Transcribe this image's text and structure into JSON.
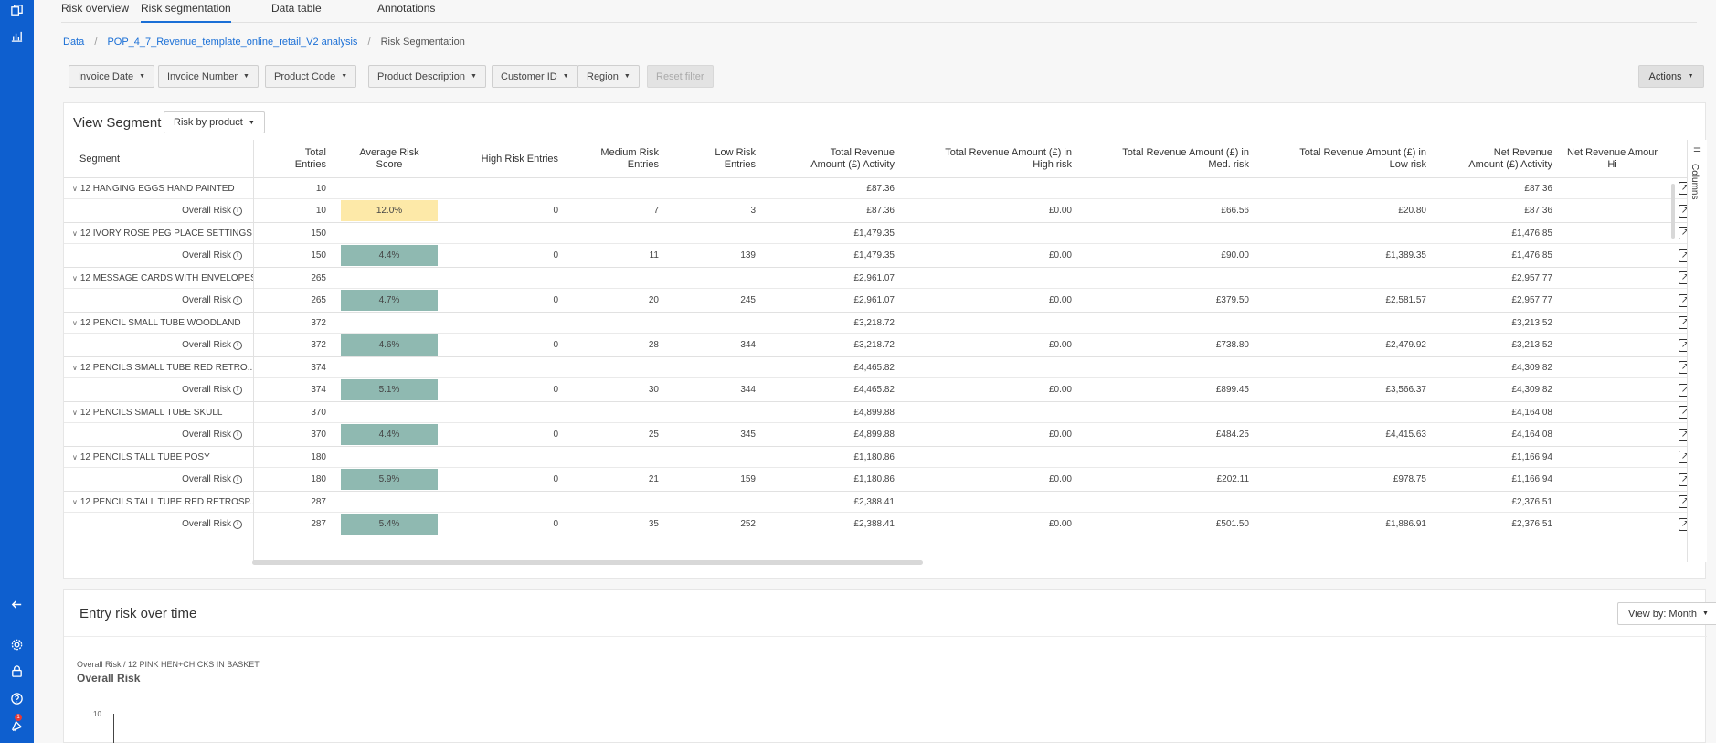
{
  "tabs": [
    "Risk overview",
    "Risk segmentation",
    "Data table",
    "Annotations"
  ],
  "active_tab": "Risk segmentation",
  "breadcrumb": {
    "root": "Data",
    "analysis": "POP_4_7_Revenue_template_online_retail_V2 analysis",
    "current": "Risk Segmentation"
  },
  "filters": [
    "Invoice Date",
    "Invoice Number",
    "Product Code",
    "Product Description",
    "Customer ID",
    "Region"
  ],
  "reset_filter": "Reset filter",
  "actions_label": "Actions",
  "view_segment": {
    "title": "View Segment",
    "selected": "Risk by product"
  },
  "columns_label": "Columns",
  "headers": {
    "segment": "Segment",
    "total_entries": [
      "Total",
      "Entries"
    ],
    "avg_score": [
      "Average Risk",
      "Score"
    ],
    "high": "High Risk Entries",
    "medium": [
      "Medium Risk",
      "Entries"
    ],
    "low": [
      "Low Risk",
      "Entries"
    ],
    "rev_activity": [
      "Total Revenue",
      "Amount (£) Activity"
    ],
    "rev_high": [
      "Total Revenue Amount (£) in",
      "High risk"
    ],
    "rev_med": [
      "Total Revenue Amount (£) in",
      "Med. risk"
    ],
    "rev_low": [
      "Total Revenue Amount (£) in",
      "Low risk"
    ],
    "net_activity": [
      "Net Revenue",
      "Amount (£) Activity"
    ],
    "net_high": [
      "Net Revenue Amour",
      "Hi"
    ]
  },
  "overall_risk_label": "Overall Risk",
  "rows": [
    {
      "name": "12 HANGING EGGS HAND PAINTED",
      "total": "10",
      "score": "12.0%",
      "high": "0",
      "medium": "7",
      "low": "3",
      "rev": "£87.36",
      "rev_high": "£0.00",
      "rev_med": "£66.56",
      "rev_low": "£20.80",
      "net": "£87.36"
    },
    {
      "name": "12 IVORY ROSE PEG PLACE SETTINGS",
      "total": "150",
      "score": "4.4%",
      "high": "0",
      "medium": "11",
      "low": "139",
      "rev": "£1,479.35",
      "rev_high": "£0.00",
      "rev_med": "£90.00",
      "rev_low": "£1,389.35",
      "net": "£1,476.85"
    },
    {
      "name": "12 MESSAGE CARDS WITH ENVELOPES",
      "total": "265",
      "score": "4.7%",
      "high": "0",
      "medium": "20",
      "low": "245",
      "rev": "£2,961.07",
      "rev_high": "£0.00",
      "rev_med": "£379.50",
      "rev_low": "£2,581.57",
      "net": "£2,957.77"
    },
    {
      "name": "12 PENCIL SMALL TUBE WOODLAND",
      "total": "372",
      "score": "4.6%",
      "high": "0",
      "medium": "28",
      "low": "344",
      "rev": "£3,218.72",
      "rev_high": "£0.00",
      "rev_med": "£738.80",
      "rev_low": "£2,479.92",
      "net": "£3,213.52"
    },
    {
      "name": "12 PENCILS SMALL TUBE RED RETRO...",
      "total": "374",
      "score": "5.1%",
      "high": "0",
      "medium": "30",
      "low": "344",
      "rev": "£4,465.82",
      "rev_high": "£0.00",
      "rev_med": "£899.45",
      "rev_low": "£3,566.37",
      "net": "£4,309.82"
    },
    {
      "name": "12 PENCILS SMALL TUBE SKULL",
      "total": "370",
      "score": "4.4%",
      "high": "0",
      "medium": "25",
      "low": "345",
      "rev": "£4,899.88",
      "rev_high": "£0.00",
      "rev_med": "£484.25",
      "rev_low": "£4,415.63",
      "net": "£4,164.08"
    },
    {
      "name": "12 PENCILS TALL TUBE POSY",
      "total": "180",
      "score": "5.9%",
      "high": "0",
      "medium": "21",
      "low": "159",
      "rev": "£1,180.86",
      "rev_high": "£0.00",
      "rev_med": "£202.11",
      "rev_low": "£978.75",
      "net": "£1,166.94"
    },
    {
      "name": "12 PENCILS TALL TUBE RED RETROSP...",
      "total": "287",
      "score": "5.4%",
      "high": "0",
      "medium": "35",
      "low": "252",
      "rev": "£2,388.41",
      "rev_high": "£0.00",
      "rev_med": "£501.50",
      "rev_low": "£1,886.91",
      "net": "£2,376.51"
    }
  ],
  "colors": {
    "accent": "#0e5fcf",
    "score_high": "#fde9a8",
    "score_normal": "#8fb9b1"
  },
  "chart_panel": {
    "title": "Entry risk over time",
    "view_by": "View by: Month",
    "subtitle": "Overall Risk / 12 PINK HEN+CHICKS IN BASKET",
    "heading": "Overall Risk",
    "y_tick": "10"
  },
  "sidebar_icons": [
    "pages-icon",
    "bar-chart-icon",
    "arrow-left-icon",
    "gear-icon",
    "lock-icon",
    "help-icon",
    "notification-icon"
  ],
  "notification_count": "1"
}
